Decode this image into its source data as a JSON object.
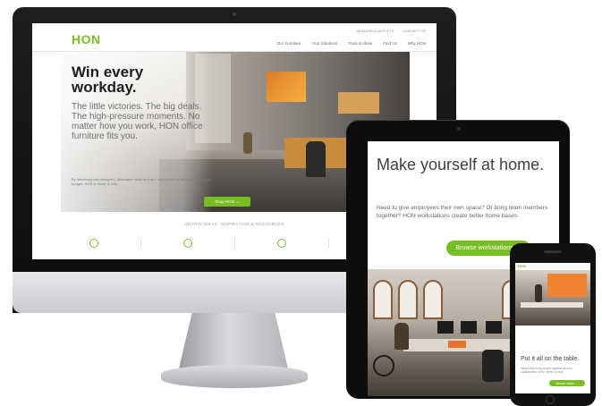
{
  "imac": {
    "site": {
      "logo": "HON",
      "utility_links": [
        "DEALERS & OUTLETS",
        "CONTACT US"
      ],
      "nav": [
        "Our Furniture",
        "Your Solutions",
        "Tools & Ideas",
        "Find Us",
        "Why HON"
      ],
      "hero": {
        "title": "Win every workday.",
        "subtitle": "The little victories. The big deals. The high-pressure moments. No matter how you work, HON office furniture fits you.",
        "fine_print": "By delivering well-designed, affordable furniture that's simply built to last and meets your budget, HON is ready to help.",
        "cta": "Shop HON →"
      },
      "section_heading": "DESIGN IDEAS, INSPIRATION & RESOURCES"
    }
  },
  "ipad": {
    "title": "Make yourself at home.",
    "body": "Need to give employees their own space? Or bring team members together? HON workstations create better home bases.",
    "cta": "Browse workstations →"
  },
  "iphone": {
    "logo": "HON",
    "title": "Put it all on the table.",
    "body": "Tables that bring people together and put collaboration at the center of work.",
    "cta": "Browse tables →"
  },
  "colors": {
    "brand_green": "#78be20",
    "device_black": "#0d0d0d",
    "aluminum": "#c9cbce"
  },
  "icons": [
    "office-icon",
    "person-icon",
    "globe-icon",
    "chart-icon"
  ]
}
